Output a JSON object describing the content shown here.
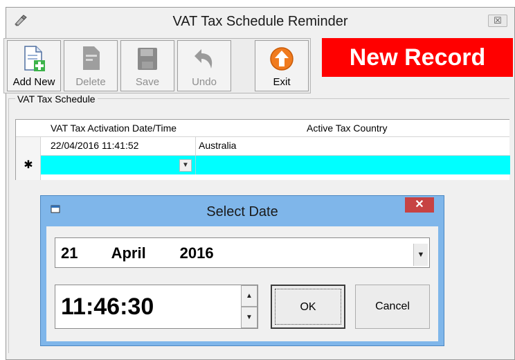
{
  "window": {
    "title": "VAT Tax Schedule Reminder",
    "close_glyph": "☒"
  },
  "toolbar": {
    "buttons": [
      {
        "label": "Add New",
        "icon": "add-document-icon",
        "enabled": true
      },
      {
        "label": "Delete",
        "icon": "delete-document-icon",
        "enabled": false
      },
      {
        "label": "Save",
        "icon": "floppy-disk-icon",
        "enabled": false
      },
      {
        "label": "Undo",
        "icon": "undo-arrow-icon",
        "enabled": false
      },
      {
        "label": "Exit",
        "icon": "exit-up-arrow-icon",
        "enabled": true
      }
    ]
  },
  "status_banner": {
    "text": "New Record",
    "bg": "#ff0000",
    "fg": "#ffffff"
  },
  "group": {
    "label": "VAT Tax Schedule"
  },
  "grid": {
    "columns": [
      "VAT Tax Activation Date/Time",
      "Active Tax Country"
    ],
    "rows": [
      [
        "22/04/2016 11:41:52",
        "Australia"
      ]
    ],
    "new_row_marker": "✱",
    "new_row_bg": "#00ffff"
  },
  "dialog": {
    "title": "Select Date",
    "close_glyph": "✕",
    "date": {
      "day": "21",
      "month": "April",
      "year": "2016"
    },
    "time": "11:46:30",
    "ok_label": "OK",
    "cancel_label": "Cancel",
    "accent": "#7fb6ea"
  }
}
